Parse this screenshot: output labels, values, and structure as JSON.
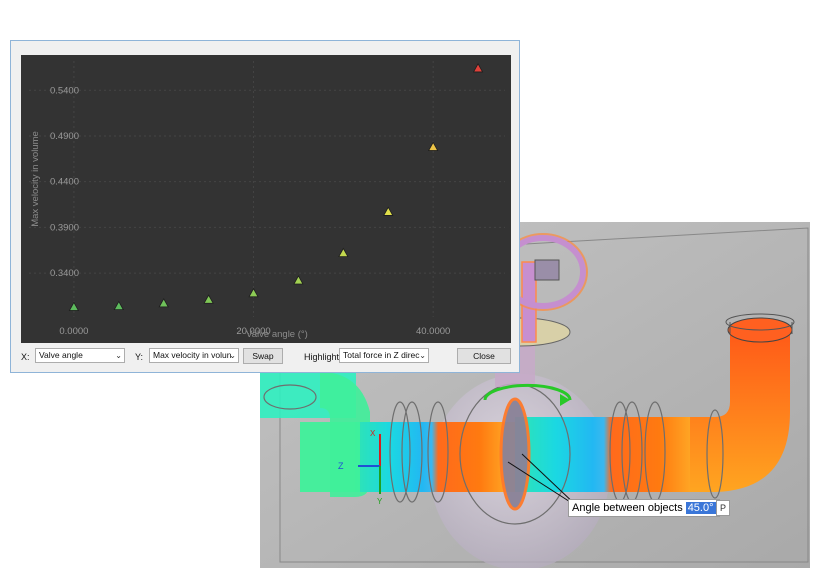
{
  "chart_data": {
    "type": "scatter",
    "xlabel": "Valve angle (°)",
    "ylabel": "Max velocity in volume",
    "xlim": [
      -5,
      48
    ],
    "ylim": [
      0.292,
      0.572
    ],
    "x_ticks": [
      {
        "value": 0,
        "label": "0.0000"
      },
      {
        "value": 20,
        "label": "20.0000"
      },
      {
        "value": 40,
        "label": "40.0000"
      }
    ],
    "y_ticks": [
      {
        "value": 0.34,
        "label": "0.3400"
      },
      {
        "value": 0.39,
        "label": "0.3900"
      },
      {
        "value": 0.44,
        "label": "0.4400"
      },
      {
        "value": 0.49,
        "label": "0.4900"
      },
      {
        "value": 0.54,
        "label": "0.5400"
      }
    ],
    "grid": true,
    "marker": "triangle",
    "points": [
      {
        "x": 0,
        "y": 0.303,
        "color": "#5dbb5d"
      },
      {
        "x": 5,
        "y": 0.304,
        "color": "#5dbb5d"
      },
      {
        "x": 10,
        "y": 0.307,
        "color": "#6fc15a"
      },
      {
        "x": 15,
        "y": 0.311,
        "color": "#7fc756"
      },
      {
        "x": 20,
        "y": 0.318,
        "color": "#8dcb55"
      },
      {
        "x": 25,
        "y": 0.332,
        "color": "#a3d152"
      },
      {
        "x": 30,
        "y": 0.362,
        "color": "#c3d84e"
      },
      {
        "x": 35,
        "y": 0.407,
        "color": "#e1e04b"
      },
      {
        "x": 40,
        "y": 0.478,
        "color": "#ecc447"
      },
      {
        "x": 45,
        "y": 0.564,
        "color": "#e0413a"
      }
    ]
  },
  "controls": {
    "x_label": "X:",
    "x_value": "Valve angle",
    "y_label": "Y:",
    "y_value": "Max velocity in volun",
    "swap_label": "Swap",
    "highlight_label": "Highlight:",
    "highlight_value": "Total force in Z direc",
    "close_label": "Close"
  },
  "viewport": {
    "triad_x": "X",
    "triad_y": "Y",
    "triad_z": "Z",
    "angle_label": "Angle between objects",
    "angle_value": "45.0°",
    "pin_glyph": "P"
  }
}
